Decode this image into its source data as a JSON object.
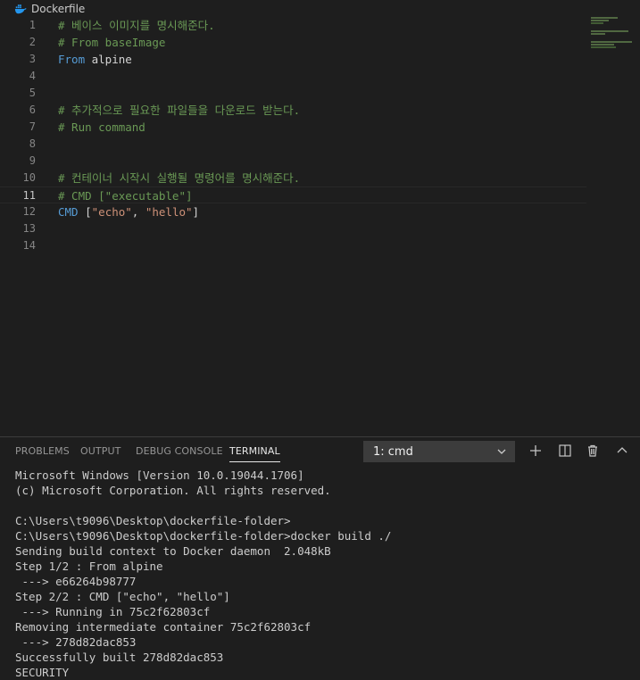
{
  "breadcrumb": {
    "file": "Dockerfile",
    "icon": "docker-whale-icon"
  },
  "editor": {
    "active_line": 11,
    "lines": [
      {
        "num": "1",
        "tokens": [
          {
            "t": "# 베이스 이미지를 명시해준다.",
            "c": "comment"
          }
        ]
      },
      {
        "num": "2",
        "tokens": [
          {
            "t": "# From baseImage",
            "c": "comment"
          }
        ]
      },
      {
        "num": "3",
        "tokens": [
          {
            "t": "From",
            "c": "kw"
          },
          {
            "t": " alpine",
            "c": "plain"
          }
        ]
      },
      {
        "num": "4",
        "tokens": []
      },
      {
        "num": "5",
        "tokens": []
      },
      {
        "num": "6",
        "tokens": [
          {
            "t": "# 추가적으로 필요한 파일들을 다운로드 받는다.",
            "c": "comment"
          }
        ]
      },
      {
        "num": "7",
        "tokens": [
          {
            "t": "# Run command",
            "c": "comment"
          }
        ]
      },
      {
        "num": "8",
        "tokens": []
      },
      {
        "num": "9",
        "tokens": []
      },
      {
        "num": "10",
        "tokens": [
          {
            "t": "# 컨테이너 시작시 실행될 명령어를 명시해준다.",
            "c": "comment"
          }
        ]
      },
      {
        "num": "11",
        "tokens": [
          {
            "t": "# CMD [\"executable\"]",
            "c": "comment"
          }
        ]
      },
      {
        "num": "12",
        "tokens": [
          {
            "t": "CMD",
            "c": "kw"
          },
          {
            "t": " [",
            "c": "plain"
          },
          {
            "t": "\"echo\"",
            "c": "str"
          },
          {
            "t": ", ",
            "c": "plain"
          },
          {
            "t": "\"hello\"",
            "c": "str"
          },
          {
            "t": "]",
            "c": "plain"
          }
        ]
      },
      {
        "num": "13",
        "tokens": []
      },
      {
        "num": "14",
        "tokens": []
      }
    ]
  },
  "panel": {
    "tabs": [
      {
        "label": "PROBLEMS",
        "active": false
      },
      {
        "label": "OUTPUT",
        "active": false
      },
      {
        "label": "DEBUG CONSOLE",
        "active": false
      },
      {
        "label": "TERMINAL",
        "active": true
      }
    ],
    "terminal_select": "1: cmd",
    "actions": [
      "plus-icon",
      "split-terminal-icon",
      "trash-icon",
      "chevron-up-icon"
    ]
  },
  "terminal": {
    "lines": [
      "Microsoft Windows [Version 10.0.19044.1706]",
      "(c) Microsoft Corporation. All rights reserved.",
      "",
      "C:\\Users\\t9096\\Desktop\\dockerfile-folder>",
      "C:\\Users\\t9096\\Desktop\\dockerfile-folder>docker build ./",
      "Sending build context to Docker daemon  2.048kB",
      "Step 1/2 : From alpine",
      " ---> e66264b98777",
      "Step 2/2 : CMD [\"echo\", \"hello\"]",
      " ---> Running in 75c2f62803cf",
      "Removing intermediate container 75c2f62803cf",
      " ---> 278d82dac853",
      "Successfully built 278d82dac853",
      "SECURITY"
    ]
  },
  "colors": {
    "background": "#1e1e1e",
    "comment": "#6a9955",
    "keyword": "#569cd6",
    "string": "#ce9178",
    "text": "#d4d4d4"
  }
}
